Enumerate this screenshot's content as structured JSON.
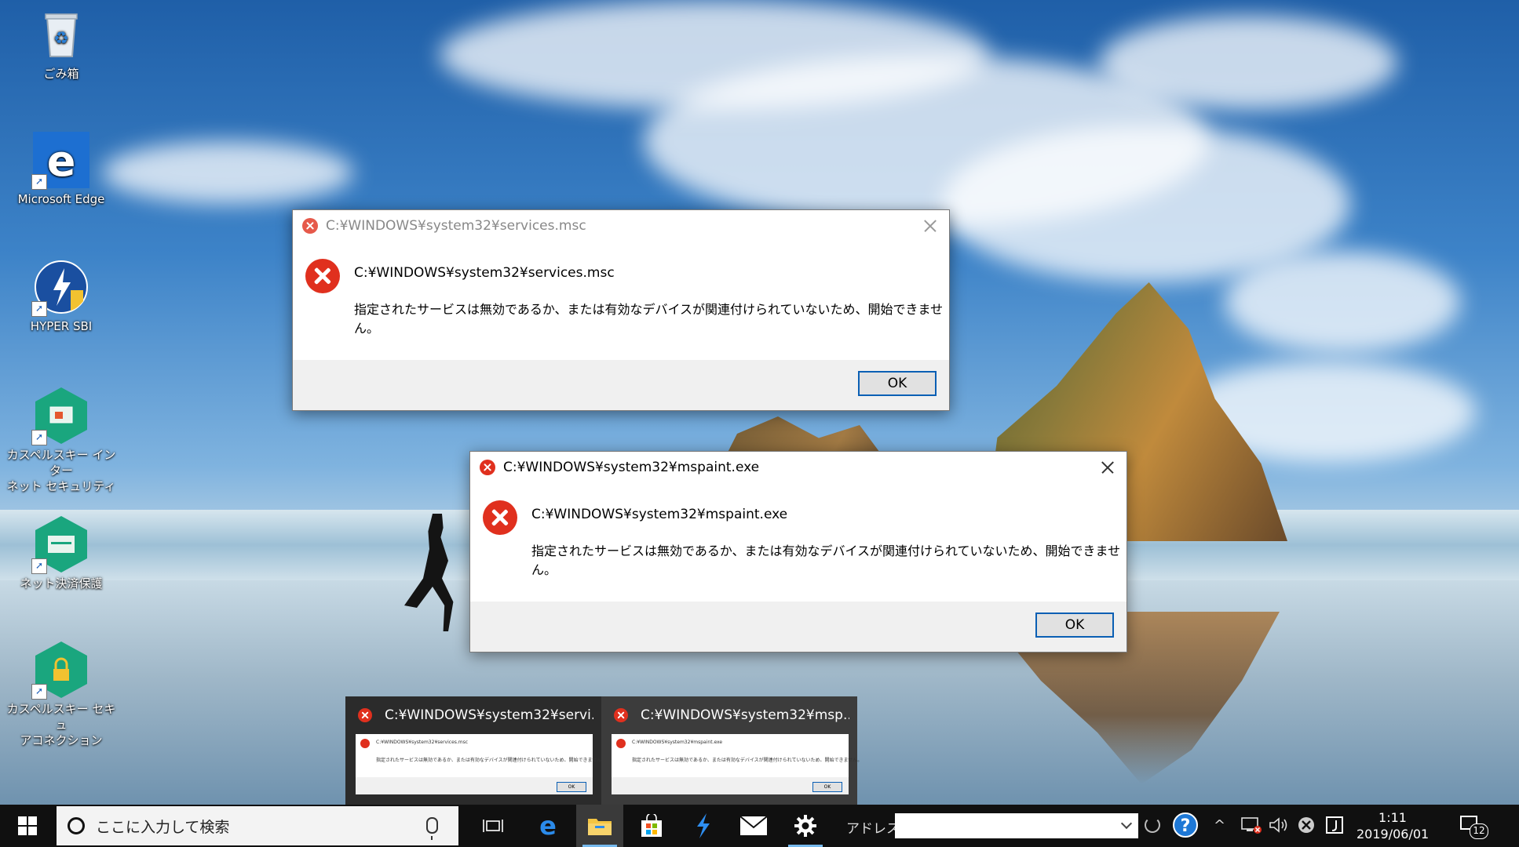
{
  "desktop": {
    "icons": [
      {
        "label": "ごみ箱"
      },
      {
        "label": "Microsoft Edge"
      },
      {
        "label": "HYPER SBI"
      },
      {
        "label_line1": "カスペルスキー インター",
        "label_line2": "ネット セキュリティ"
      },
      {
        "label": "ネット決済保護"
      },
      {
        "label_line1": "カスペルスキー セキュ",
        "label_line2": "アコネクション"
      }
    ]
  },
  "dialogs": [
    {
      "title": "C:¥WINDOWS¥system32¥services.msc",
      "path": "C:¥WINDOWS¥system32¥services.msc",
      "message": "指定されたサービスは無効であるか、または有効なデバイスが関連付けられていないため、開始できません。",
      "ok_label": "OK",
      "state": "inactive"
    },
    {
      "title": "C:¥WINDOWS¥system32¥mspaint.exe",
      "path": "C:¥WINDOWS¥system32¥mspaint.exe",
      "message": "指定されたサービスは無効であるか、または有効なデバイスが関連付けられていないため、開始できません。",
      "ok_label": "OK",
      "state": "active"
    }
  ],
  "thumbnails": [
    {
      "title": "C:¥WINDOWS¥system32¥servi...",
      "mini_title": "C:¥WINDOWS¥system32¥services.msc",
      "mini_text": "指定されたサービスは無効であるか、または有効なデバイスが関連付けられていないため、開始できません。",
      "ok_label": "OK"
    },
    {
      "title": "C:¥WINDOWS¥system32¥msp...",
      "mini_title": "C:¥WINDOWS¥system32¥mspaint.exe",
      "mini_text": "指定されたサービスは無効であるか、または有効なデバイスが関連付けられていないため、開始できません。",
      "ok_label": "OK"
    }
  ],
  "taskbar": {
    "search_placeholder": "ここに入力して検索",
    "address_label": "アドレス",
    "address_value": "",
    "help_glyph": "?",
    "clock_time": "1:11",
    "clock_date": "2019/06/01",
    "notification_count": "12",
    "apps": [
      "task-view-icon",
      "edge-icon",
      "file-explorer-icon",
      "store-icon",
      "hyper-sbi-icon",
      "mail-icon",
      "settings-icon"
    ]
  },
  "colors": {
    "error_red": "#e0301e",
    "button_border": "#0a5fb4",
    "taskbar_bg": "#101010",
    "kaspersky_green": "#1aa67e"
  }
}
